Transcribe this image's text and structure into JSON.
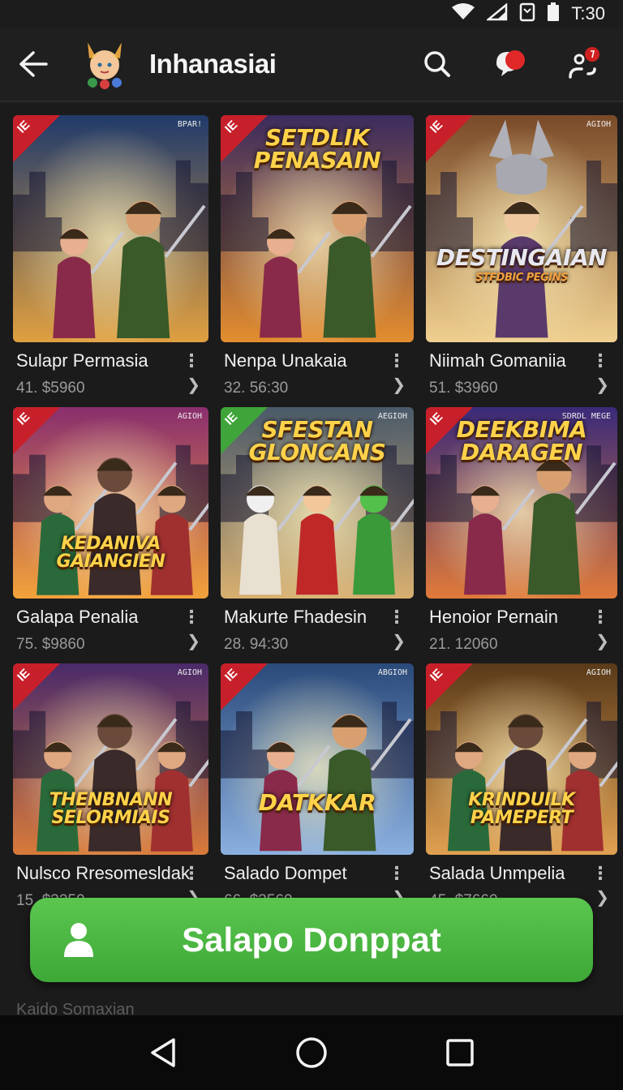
{
  "status_bar": {
    "time": "T:30"
  },
  "app_bar": {
    "title": "Inhanasiai"
  },
  "games": [
    {
      "name": "Sulapr Permasia",
      "price": "41. $5960",
      "art_title": "",
      "ribbon": "red",
      "tag": "BPAR!",
      "bg": [
        "#203a6b",
        "#e0a040"
      ],
      "art": "heroes"
    },
    {
      "name": "Nenpa Unakaia",
      "price": "32. 56:30",
      "art_title": "SETDLIK PENASAIN",
      "ribbon": "red",
      "tag": "",
      "bg": [
        "#3b2b5e",
        "#e38d2e"
      ],
      "art": "heroes"
    },
    {
      "name": "Niimah Gomaniia",
      "price": "51. $3960",
      "art_title": "DESTINGAIAN",
      "ribbon": "red",
      "tag": "AGIOH",
      "bg": [
        "#7a4a28",
        "#f0d090"
      ],
      "art": "mask",
      "art_subtitle": "STFDBIC PEGINS"
    },
    {
      "name": "Galapa Penalia",
      "price": "75. $9860",
      "art_title": "KEDANIVA GAIANGIEN",
      "ribbon": "red",
      "tag": "AGIOH",
      "bg": [
        "#8a2e6e",
        "#f2a23a"
      ],
      "art": "villain"
    },
    {
      "name": "Makurte Fhadesin",
      "price": "28. 94:30",
      "art_title": "SFESTAN GLONCANS",
      "ribbon": "green",
      "tag": "AEGIOH",
      "bg": [
        "#4a5a6a",
        "#d8b070"
      ],
      "art": "pets"
    },
    {
      "name": "Henoior Pernain",
      "price": "21. 12060",
      "art_title": "DEEKBIMA DARAGEN",
      "ribbon": "red",
      "tag": "SDRDL MEGE",
      "bg": [
        "#3a2a7a",
        "#e07a3a"
      ],
      "art": "heroes"
    },
    {
      "name": "Nulsco Rresomesldak",
      "price": "15. $3250",
      "art_title": "THENBNANN SELORMIAIS",
      "ribbon": "red",
      "tag": "AGIOH",
      "bg": [
        "#4a2a6a",
        "#d87a3a"
      ],
      "art": "villain"
    },
    {
      "name": "Salado Dompet",
      "price": "66. $3560",
      "art_title": "DATKKAR",
      "ribbon": "red",
      "tag": "ABGIOH",
      "bg": [
        "#2a4a7a",
        "#8ab0e0"
      ],
      "art": "heroes"
    },
    {
      "name": "Salada Unmpelia",
      "price": "45. $7660",
      "art_title": "KRINDUILK PAMEPERT",
      "ribbon": "red",
      "tag": "AGIOH",
      "bg": [
        "#5a3a1a",
        "#e0a050"
      ],
      "art": "villain"
    }
  ],
  "cta": {
    "label": "Salapo Donppat"
  },
  "footer": {
    "text": "Kaido Somaxian"
  },
  "colors": {
    "accent": "#4cb944",
    "background": "#1b1b1b",
    "ribbon_red": "#c8202a",
    "ribbon_green": "#3fa53a"
  },
  "icons": [
    "back-arrow-icon",
    "search-icon",
    "chat-bubble-icon",
    "profile-icon",
    "user-icon",
    "nav-back-icon",
    "nav-home-icon",
    "nav-recents-icon"
  ]
}
